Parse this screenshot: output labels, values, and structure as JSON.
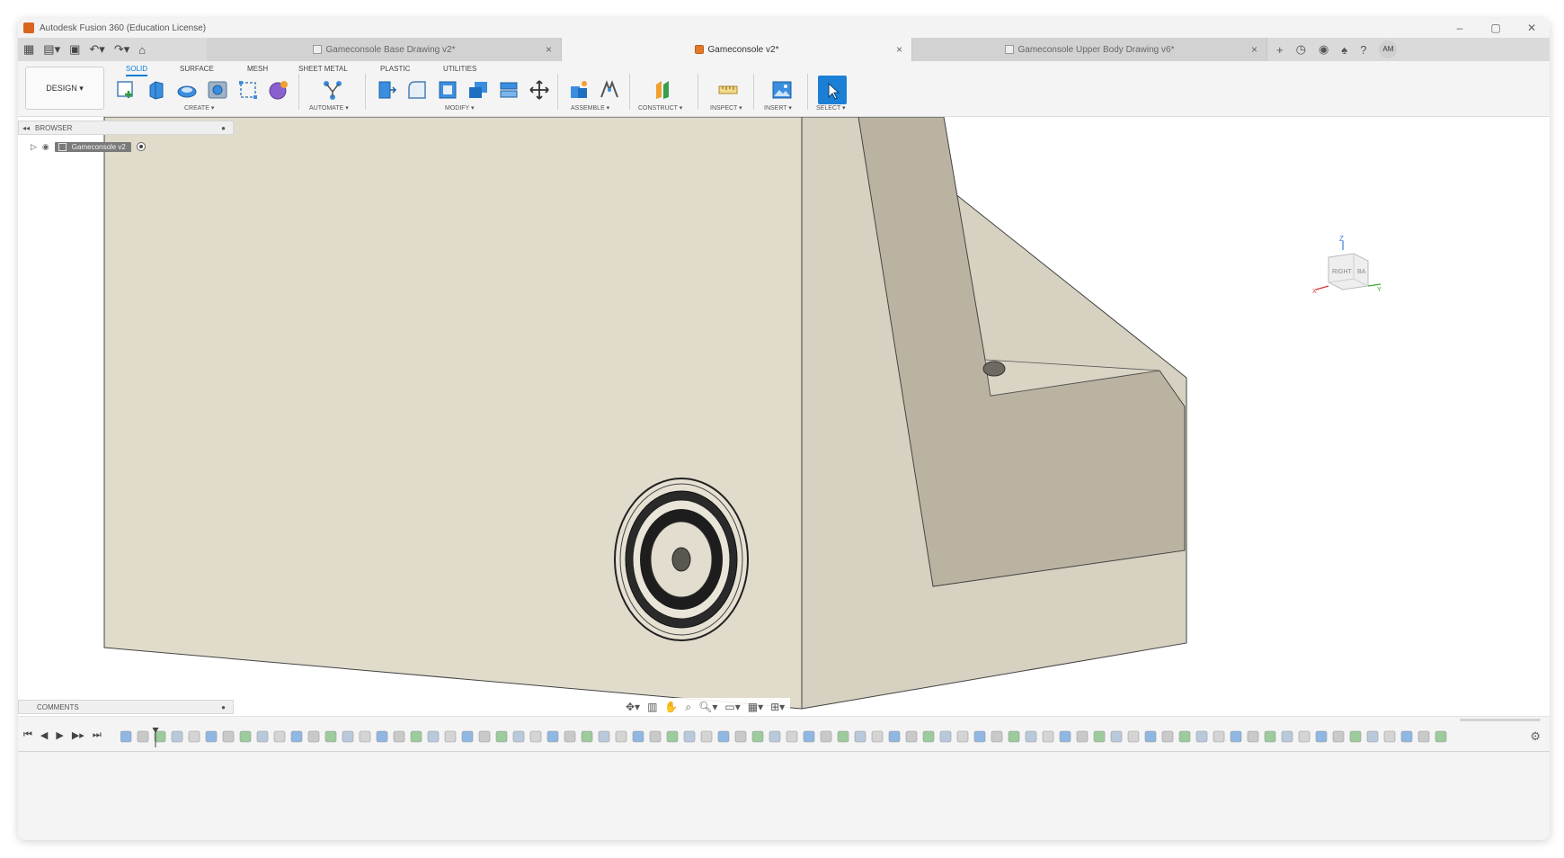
{
  "window": {
    "title": "Autodesk Fusion 360 (Education License)",
    "controls": [
      "–",
      "▢",
      "✕"
    ]
  },
  "quick_access": {
    "icons": [
      "grid-icon",
      "file-icon",
      "save-icon",
      "undo-icon",
      "redo-icon",
      "home-icon"
    ]
  },
  "document_tabs": [
    {
      "label": "Gameconsole Base Drawing v2*",
      "active": false
    },
    {
      "label": "Gameconsole v2*",
      "active": true
    },
    {
      "label": "Gameconsole Upper Body Drawing v6*",
      "active": false
    }
  ],
  "tab_close_glyph": "×",
  "user": {
    "initials": "AM"
  },
  "workspace": {
    "label": "DESIGN ▾"
  },
  "ribbon_tabs": [
    "SOLID",
    "SURFACE",
    "MESH",
    "SHEET METAL",
    "PLASTIC",
    "UTILITIES"
  ],
  "tool_groups": {
    "create": "CREATE ▾",
    "automate": "AUTOMATE ▾",
    "modify": "MODIFY ▾",
    "assemble": "ASSEMBLE ▾",
    "construct": "CONSTRUCT ▾",
    "inspect": "INSPECT ▾",
    "insert": "INSERT ▾",
    "select": "SELECT ▾"
  },
  "browser": {
    "title": "BROWSER",
    "component": "Gameconsole v2"
  },
  "viewcube": {
    "top_label": "Z",
    "front_label": "RIGHT",
    "side_label": "BA",
    "x_label": "X",
    "y_label": "Y"
  },
  "comments": {
    "title": "COMMENTS"
  },
  "colors": {
    "accent": "#0b7fd6",
    "model_face_front": "#e0dbcb",
    "model_face_side": "#d6d1c0",
    "model_face_dark": "#bbb3a2",
    "active_tab_icon": "#e07a2a"
  }
}
